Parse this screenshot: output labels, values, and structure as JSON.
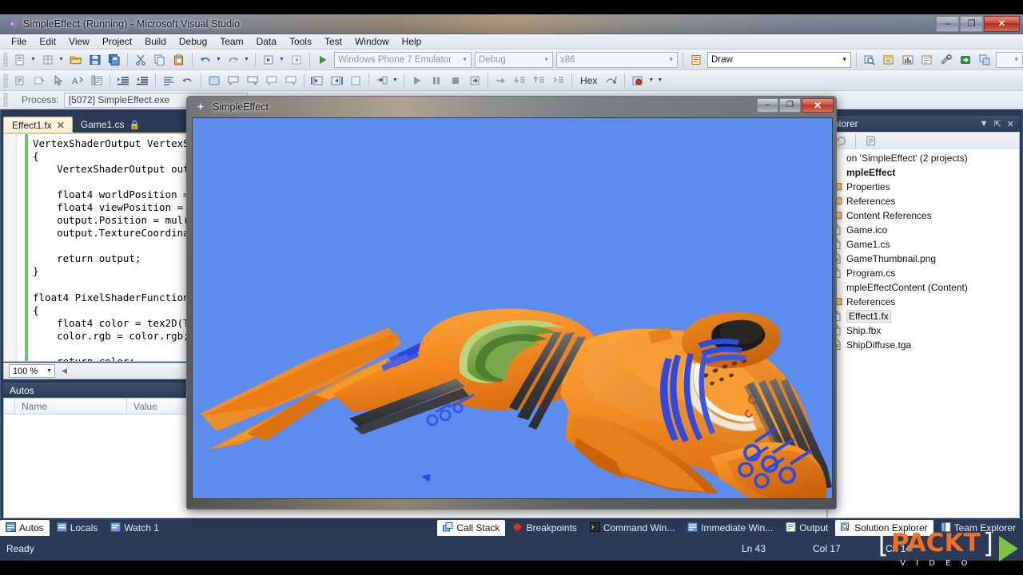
{
  "window": {
    "title": "SimpleEffect (Running) - Microsoft Visual Studio",
    "icon": "visual-studio-icon",
    "minimize": "–",
    "maximize": "❐",
    "close": "✕"
  },
  "menubar": {
    "items": [
      "File",
      "Edit",
      "View",
      "Project",
      "Build",
      "Debug",
      "Team",
      "Data",
      "Tools",
      "Test",
      "Window",
      "Help"
    ]
  },
  "toolbar_standard": {
    "target_platform": "Windows Phone 7 Emulator",
    "configuration": "Debug",
    "architecture": "x86",
    "find_combo": "Draw",
    "hex_label": "Hex"
  },
  "process_row": {
    "label": "Process:",
    "value": "[5072] SimpleEffect.exe"
  },
  "editor": {
    "tabs": [
      {
        "label": "Effect1.fx",
        "active": true,
        "closable": true,
        "locked": false
      },
      {
        "label": "Game1.cs",
        "active": false,
        "closable": false,
        "locked": true
      }
    ],
    "zoom": "100 %",
    "code": "VertexShaderOutput VertexSh\n{\n    VertexShaderOutput outp\n\n    float4 worldPosition = \n    float4 viewPosition = m\n    output.Position = mul(v\n    output.TextureCoordinat\n\n    return output;\n}\n\nfloat4 PixelShaderFunction(\n{\n    float4 color = tex2D(Te\n    color.rgb = color.rgb;\n\n    return color;"
  },
  "autos": {
    "title": "Autos",
    "columns": [
      "Name",
      "Value"
    ],
    "rows": []
  },
  "solution_explorer": {
    "title": "Solution Explorer",
    "title_visible": "plorer",
    "header_buttons": [
      "chevron-down-icon",
      "pin-icon",
      "close-icon"
    ],
    "tree": [
      {
        "label": "on 'SimpleEffect' (2 projects)",
        "indent": 0,
        "bold": false,
        "icon": "solution-icon",
        "selected": false
      },
      {
        "label": "mpleEffect",
        "indent": 0,
        "bold": true,
        "icon": "project-icon",
        "selected": false
      },
      {
        "label": "Properties",
        "indent": 1,
        "bold": false,
        "icon": "folder-icon",
        "selected": false
      },
      {
        "label": "References",
        "indent": 1,
        "bold": false,
        "icon": "folder-icon",
        "selected": false
      },
      {
        "label": "Content References",
        "indent": 1,
        "bold": false,
        "icon": "folder-icon",
        "selected": false
      },
      {
        "label": "Game.ico",
        "indent": 1,
        "bold": false,
        "icon": "file-icon",
        "selected": false
      },
      {
        "label": "Game1.cs",
        "indent": 1,
        "bold": false,
        "icon": "csharp-file-icon",
        "selected": false
      },
      {
        "label": "GameThumbnail.png",
        "indent": 1,
        "bold": false,
        "icon": "image-file-icon",
        "selected": false
      },
      {
        "label": "Program.cs",
        "indent": 1,
        "bold": false,
        "icon": "csharp-file-icon",
        "selected": false
      },
      {
        "label": "mpleEffectContent (Content)",
        "indent": 0,
        "bold": false,
        "icon": "project-icon",
        "selected": false
      },
      {
        "label": "References",
        "indent": 1,
        "bold": false,
        "icon": "folder-icon",
        "selected": false
      },
      {
        "label": "Effect1.fx",
        "indent": 1,
        "bold": false,
        "icon": "file-icon",
        "selected": true
      },
      {
        "label": "Ship.fbx",
        "indent": 1,
        "bold": false,
        "icon": "file-icon",
        "selected": false
      },
      {
        "label": "ShipDiffuse.tga",
        "indent": 1,
        "bold": false,
        "icon": "image-file-icon",
        "selected": false
      }
    ]
  },
  "dock_tabs_left": [
    {
      "label": "Autos",
      "icon": "autos-icon",
      "active": true
    },
    {
      "label": "Locals",
      "icon": "locals-icon",
      "active": false
    },
    {
      "label": "Watch 1",
      "icon": "watch-icon",
      "active": false
    }
  ],
  "dock_tabs_right": [
    {
      "label": "Call Stack",
      "icon": "call-stack-icon",
      "active": true
    },
    {
      "label": "Breakpoints",
      "icon": "breakpoint-icon",
      "active": false
    },
    {
      "label": "Command Win...",
      "icon": "command-window-icon",
      "active": false
    },
    {
      "label": "Immediate Win...",
      "icon": "immediate-window-icon",
      "active": false
    },
    {
      "label": "Output",
      "icon": "output-icon",
      "active": false
    },
    {
      "label": "Solution Explorer",
      "icon": "solution-explorer-icon",
      "active": true
    },
    {
      "label": "Team Explorer",
      "icon": "team-explorer-icon",
      "active": false
    }
  ],
  "status_bar": {
    "message": "Ready",
    "line": "Ln 43",
    "column": "Col 17",
    "character": "Ch 14"
  },
  "game_window": {
    "title": "SimpleEffect",
    "icon": "xna-game-icon",
    "minimize": "–",
    "maximize": "❐",
    "close": "✕",
    "background_color": "#5C8CED",
    "model": "orange-spaceship"
  },
  "branding": {
    "name": "PACKT",
    "subtitle": "V I D E O",
    "bracket_left": "[",
    "bracket_right": "]",
    "accent_color": "#F07021",
    "play_color": "#7DC242"
  }
}
